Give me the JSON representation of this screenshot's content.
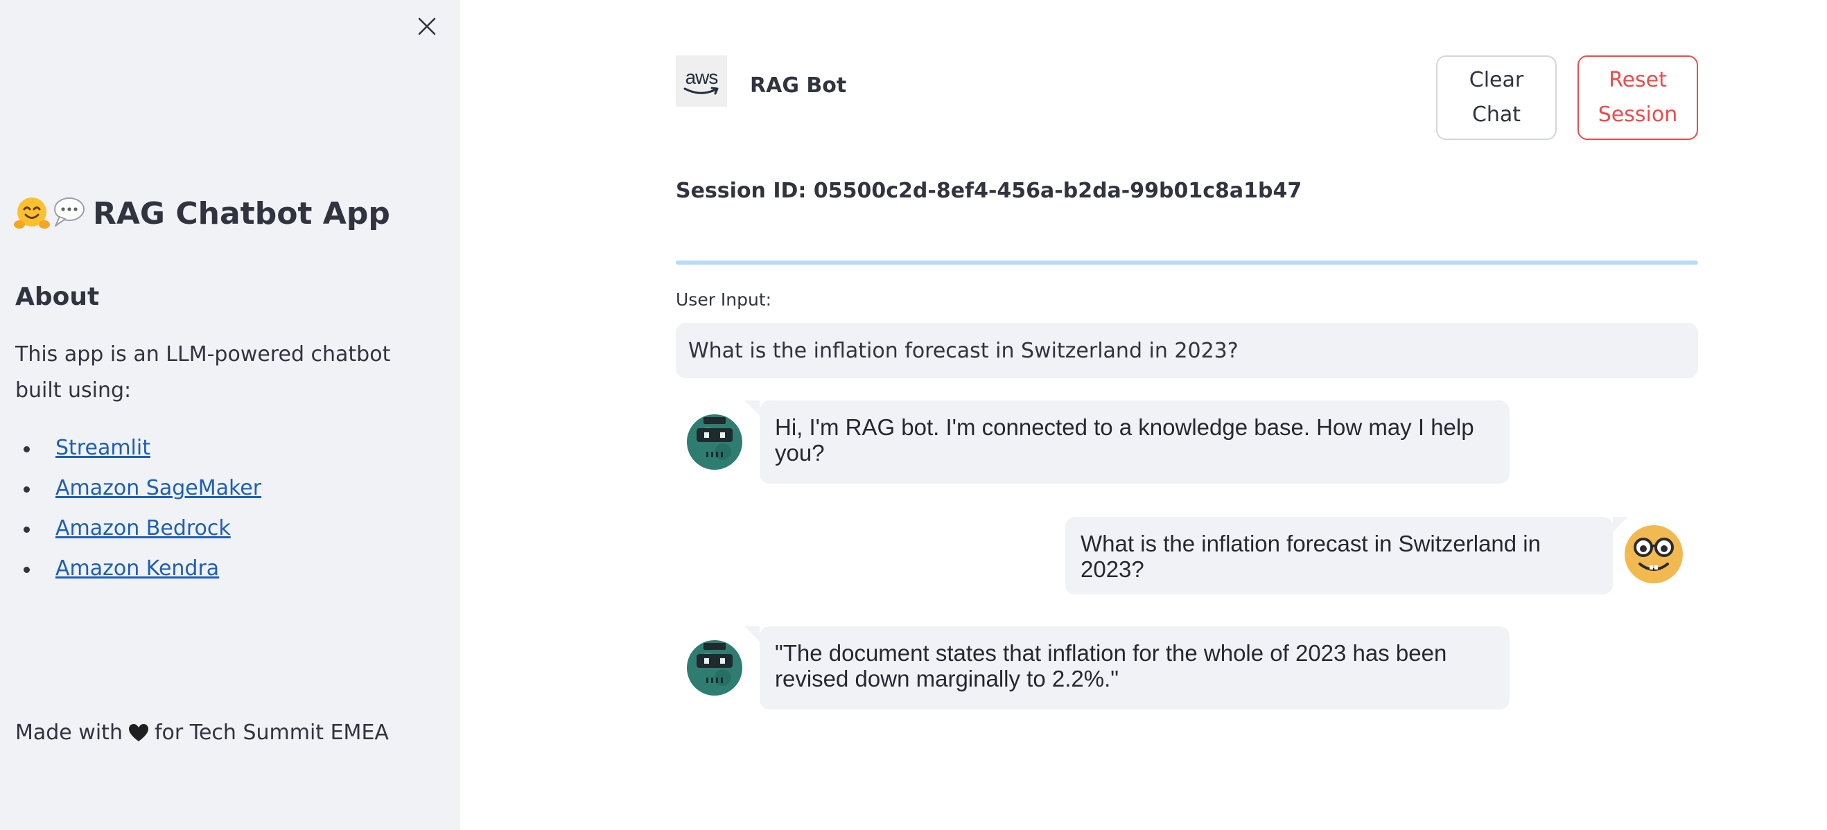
{
  "sidebar": {
    "title": "RAG Chatbot App",
    "title_icons": [
      "hugging-face-emoji",
      "speech-bubble-emoji"
    ],
    "about_heading": "About",
    "description": "This app is an LLM-powered chatbot built using:",
    "links": [
      {
        "label": "Streamlit"
      },
      {
        "label": "Amazon SageMaker"
      },
      {
        "label": "Amazon Bedrock"
      },
      {
        "label": "Amazon Kendra"
      }
    ],
    "footer_prefix": "Made with",
    "footer_icon": "heart-icon",
    "footer_suffix": "for Tech Summit EMEA"
  },
  "header": {
    "logo_text": "aws",
    "app_name": "RAG Bot",
    "clear_button": "Clear Chat",
    "reset_button": "Reset Session"
  },
  "session": {
    "label": "Session ID: 05500c2d-8ef4-456a-b2da-99b01c8a1b47"
  },
  "input": {
    "label": "User Input:",
    "value": "What is the inflation forecast in Switzerland in 2023?"
  },
  "messages": [
    {
      "role": "bot",
      "avatar": "robot-avatar",
      "text": "Hi, I'm RAG bot. I'm connected to a knowledge base. How may I help you?"
    },
    {
      "role": "user",
      "avatar": "nerd-face-avatar",
      "text": "What is the inflation forecast in Switzerland in 2023?"
    },
    {
      "role": "bot",
      "avatar": "robot-avatar",
      "text": "\"The document states that inflation for the whole of 2023 has been revised down marginally to 2.2%.\""
    }
  ],
  "colors": {
    "sidebar_bg": "#f0f2f6",
    "link": "#1c5fb8",
    "reset_accent": "#ef4a4a",
    "divider": "#b8dcf7",
    "bubble_bg": "#f0f2f6"
  }
}
